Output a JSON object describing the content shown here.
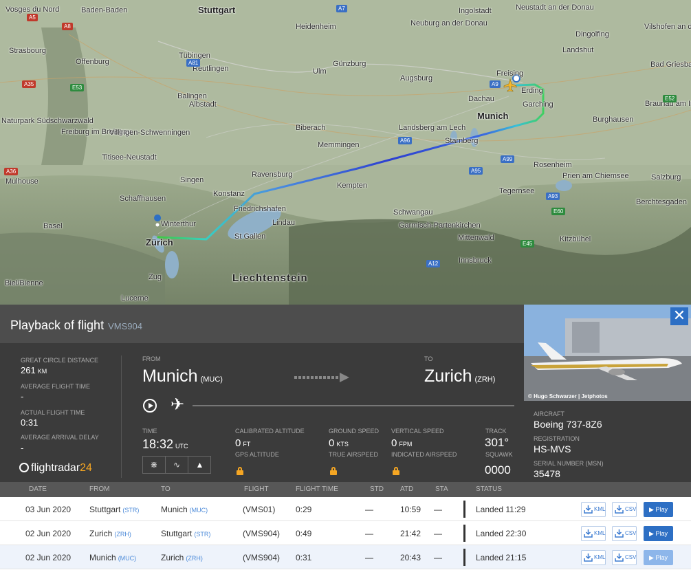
{
  "map": {
    "places": [
      {
        "name": "Stuttgart",
        "cls": "big"
      },
      {
        "name": "Baden-Baden",
        "cls": ""
      },
      {
        "name": "Heidenheim",
        "cls": ""
      },
      {
        "name": "Ingolstadt",
        "cls": ""
      },
      {
        "name": "Neuburg an der Donau",
        "cls": ""
      },
      {
        "name": "Neustadt an der Donau",
        "cls": ""
      },
      {
        "name": "Dingolfing",
        "cls": ""
      },
      {
        "name": "Vilshofen an der Donau",
        "cls": ""
      },
      {
        "name": "Strasbourg",
        "cls": ""
      },
      {
        "name": "Offenburg",
        "cls": ""
      },
      {
        "name": "Tübingen",
        "cls": ""
      },
      {
        "name": "Reutlingen",
        "cls": ""
      },
      {
        "name": "Ulm",
        "cls": ""
      },
      {
        "name": "Günzburg",
        "cls": ""
      },
      {
        "name": "Augsburg",
        "cls": ""
      },
      {
        "name": "Freising",
        "cls": ""
      },
      {
        "name": "Landshut",
        "cls": ""
      },
      {
        "name": "Bad Griesbach",
        "cls": ""
      },
      {
        "name": "Balingen",
        "cls": ""
      },
      {
        "name": "Albstadt",
        "cls": ""
      },
      {
        "name": "Dachau",
        "cls": ""
      },
      {
        "name": "Erding",
        "cls": ""
      },
      {
        "name": "Garching",
        "cls": ""
      },
      {
        "name": "Munich",
        "cls": "big"
      },
      {
        "name": "Burghausen",
        "cls": ""
      },
      {
        "name": "Braunau am Inn",
        "cls": ""
      },
      {
        "name": "Freiburg im Breisgau",
        "cls": ""
      },
      {
        "name": "Villingen-Schwenningen",
        "cls": ""
      },
      {
        "name": "Biberach",
        "cls": ""
      },
      {
        "name": "Memmingen",
        "cls": ""
      },
      {
        "name": "Landsberg am Lech",
        "cls": ""
      },
      {
        "name": "Starnberg",
        "cls": ""
      },
      {
        "name": "Titisee-Neustadt",
        "cls": ""
      },
      {
        "name": "Rosenheim",
        "cls": ""
      },
      {
        "name": "Prien am Chiemsee",
        "cls": ""
      },
      {
        "name": "Mulhouse",
        "cls": ""
      },
      {
        "name": "Singen",
        "cls": ""
      },
      {
        "name": "Ravensburg",
        "cls": ""
      },
      {
        "name": "Kempten",
        "cls": ""
      },
      {
        "name": "Salzburg",
        "cls": ""
      },
      {
        "name": "Schaffhausen",
        "cls": ""
      },
      {
        "name": "Konstanz",
        "cls": ""
      },
      {
        "name": "Tegernsee",
        "cls": ""
      },
      {
        "name": "Friedrichshafen",
        "cls": ""
      },
      {
        "name": "Berchtesgaden",
        "cls": ""
      },
      {
        "name": "Basel",
        "cls": ""
      },
      {
        "name": "Winterthur",
        "cls": ""
      },
      {
        "name": "Lindau",
        "cls": ""
      },
      {
        "name": "Schwangau",
        "cls": ""
      },
      {
        "name": "Garmisch-Partenkirchen",
        "cls": ""
      },
      {
        "name": "Zürich",
        "cls": "big"
      },
      {
        "name": "St Gallen",
        "cls": ""
      },
      {
        "name": "Mittenwald",
        "cls": ""
      },
      {
        "name": "Kitzbühel",
        "cls": ""
      },
      {
        "name": "Innsbruck",
        "cls": ""
      },
      {
        "name": "Liechtenstein",
        "cls": "xl"
      },
      {
        "name": "Zug",
        "cls": ""
      },
      {
        "name": "Biel/Bienne",
        "cls": ""
      },
      {
        "name": "Lucerne",
        "cls": ""
      },
      {
        "name": "Vosges du Nord",
        "cls": ""
      },
      {
        "name": "Naturpark Südschwarzwald",
        "cls": ""
      }
    ],
    "roads": [
      "A8",
      "A5",
      "A35",
      "A81",
      "A7",
      "A9",
      "E53",
      "A96",
      "E52",
      "A99",
      "A95",
      "A93",
      "E45",
      "E60",
      "A12",
      "A36"
    ]
  },
  "panel": {
    "title": "Playback of flight",
    "flight": "VMS904",
    "distance_label": "GREAT CIRCLE DISTANCE",
    "distance_value": "261",
    "distance_unit": "KM",
    "avg_time_label": "AVERAGE FLIGHT TIME",
    "avg_time_value": "-",
    "actual_time_label": "ACTUAL FLIGHT TIME",
    "actual_time_value": "0:31",
    "avg_delay_label": "AVERAGE ARRIVAL DELAY",
    "avg_delay_value": "-",
    "from_label": "FROM",
    "from_city": "Munich",
    "from_code": "(MUC)",
    "to_label": "TO",
    "to_city": "Zurich",
    "to_code": "(ZRH)",
    "time_label": "TIME",
    "time_value": "18:32",
    "time_unit": "UTC",
    "cal_alt_label": "CALIBRATED ALTITUDE",
    "cal_alt_value": "0",
    "cal_alt_unit": "FT",
    "gps_alt_label": "GPS ALTITUDE",
    "ground_speed_label": "GROUND SPEED",
    "ground_speed_value": "0",
    "ground_speed_unit": "KTS",
    "true_air_label": "TRUE AIRSPEED",
    "vert_speed_label": "VERTICAL SPEED",
    "vert_speed_value": "0",
    "vert_speed_unit": "FPM",
    "ind_air_label": "INDICATED AIRSPEED",
    "track_label": "TRACK",
    "track_value": "301°",
    "squawk_label": "SQUAWK",
    "squawk_value": "0000",
    "logo_text": "flightradar",
    "logo_num": "24",
    "playback_progress": 0.0
  },
  "aircraft": {
    "credit": "© Hugo Schwarzer | Jetphotos",
    "aircraft_label": "AIRCRAFT",
    "aircraft_value": "Boeing 737-8Z6",
    "reg_label": "REGISTRATION",
    "reg_value": "HS-MVS",
    "msn_label": "SERIAL NUMBER (MSN)",
    "msn_value": "35478"
  },
  "table": {
    "headers": [
      "DATE",
      "FROM",
      "TO",
      "FLIGHT",
      "FLIGHT TIME",
      "STD",
      "ATD",
      "STA",
      "STATUS"
    ],
    "rows": [
      {
        "date": "03 Jun 2020",
        "from": "Stuttgart",
        "from_code": "(STR)",
        "to": "Munich",
        "to_code": "(MUC)",
        "flight": "(VMS01)",
        "ftime": "0:29",
        "std": "—",
        "atd": "10:59",
        "sta": "—",
        "status": "Landed 11:29",
        "kml": "KML",
        "csv": "CSV",
        "play": "▶ Play"
      },
      {
        "date": "02 Jun 2020",
        "from": "Zurich",
        "from_code": "(ZRH)",
        "to": "Stuttgart",
        "to_code": "(STR)",
        "flight": "(VMS904)",
        "ftime": "0:49",
        "std": "—",
        "atd": "21:42",
        "sta": "—",
        "status": "Landed 22:30",
        "kml": "KML",
        "csv": "CSV",
        "play": "▶ Play"
      },
      {
        "date": "02 Jun 2020",
        "from": "Munich",
        "from_code": "(MUC)",
        "to": "Zurich",
        "to_code": "(ZRH)",
        "flight": "(VMS904)",
        "ftime": "0:31",
        "std": "—",
        "atd": "20:43",
        "sta": "—",
        "status": "Landed 21:15",
        "kml": "KML",
        "csv": "CSV",
        "play": "▶ Play"
      }
    ]
  }
}
